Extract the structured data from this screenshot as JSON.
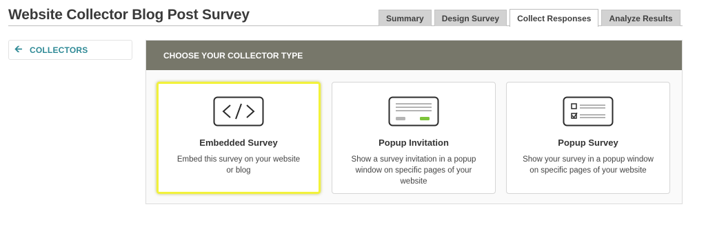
{
  "header": {
    "title": "Website Collector Blog Post Survey",
    "tabs": [
      {
        "label": "Summary"
      },
      {
        "label": "Design Survey"
      },
      {
        "label": "Collect Responses"
      },
      {
        "label": "Analyze Results"
      }
    ],
    "active_tab": "Collect Responses"
  },
  "sidebar": {
    "collectors_label": "COLLECTORS",
    "collectors_icon": "arrow-left-icon"
  },
  "panel": {
    "title": "CHOOSE YOUR COLLECTOR TYPE",
    "cards": [
      {
        "title": "Embedded Survey",
        "description": "Embed this survey on your website or blog",
        "icon": "code-icon",
        "selected": true
      },
      {
        "title": "Popup Invitation",
        "description": "Show a survey invitation in a popup window on specific pages of your website",
        "icon": "popup-invitation-icon",
        "selected": false
      },
      {
        "title": "Popup Survey",
        "description": "Show your survey in a popup window on specific pages of your website",
        "icon": "popup-survey-icon",
        "selected": false
      }
    ]
  },
  "colors": {
    "accent": "#2f8a96",
    "header_bar": "#77776a",
    "selection_highlight": "#f2f23a",
    "button_green": "#7dc43b"
  }
}
